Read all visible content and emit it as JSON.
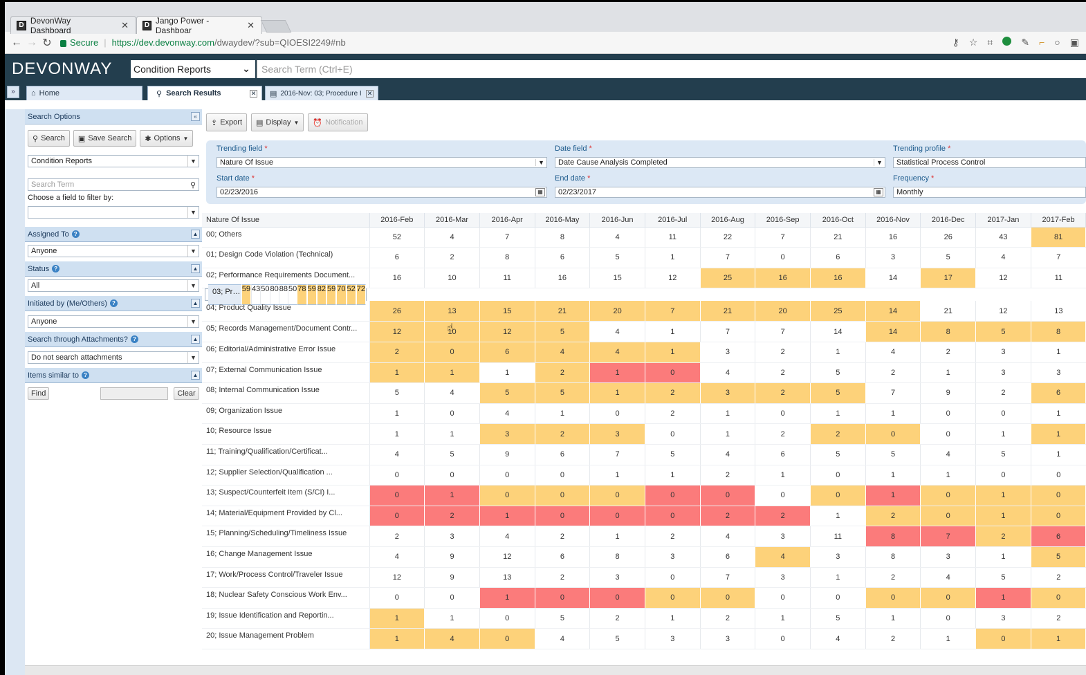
{
  "browser": {
    "tabs": [
      {
        "label": "DevonWay Dashboard",
        "active": false
      },
      {
        "label": "Jango Power - Dashboar",
        "active": true
      }
    ],
    "secure_label": "Secure",
    "url_scheme_host": "https://dev.devonway.com",
    "url_rest": "/dwaydev/?sub=QIOESI2249#nb"
  },
  "app": {
    "logo": "DEVONWAY",
    "module": "Condition Reports",
    "search_placeholder": "Search Term (Ctrl+E)",
    "tabs": [
      {
        "label": "Home"
      },
      {
        "label": "Search Results"
      },
      {
        "label": "2016-Nov: 03; Procedure I"
      }
    ]
  },
  "left": {
    "header": "Search Options",
    "buttons": [
      "Search",
      "Save Search",
      "Options"
    ],
    "module_select": "Condition Reports",
    "search_placeholder": "Search Term",
    "filter_label": "Choose a field to filter by:",
    "filter_value": "",
    "filters": [
      {
        "label": "Assigned To",
        "value": "Anyone"
      },
      {
        "label": "Status",
        "value": "All"
      },
      {
        "label": "Initiated by (Me/Others)",
        "value": "Anyone"
      },
      {
        "label": "Search through Attachments?",
        "value": "Do not search attachments"
      }
    ],
    "similar_label": "Items similar to",
    "find_label": "Find",
    "clear_label": "Clear"
  },
  "toolbar": {
    "export": "Export",
    "display": "Display",
    "notification": "Notification"
  },
  "criteria": {
    "trending_field_label": "Trending field",
    "trending_field": "Nature Of Issue",
    "date_field_label": "Date field",
    "date_field": "Date Cause Analysis Completed",
    "trending_profile_label": "Trending profile",
    "trending_profile": "Statistical Process Control",
    "start_date_label": "Start date",
    "start_date": "02/23/2016",
    "end_date_label": "End date",
    "end_date": "02/23/2017",
    "frequency_label": "Frequency",
    "frequency": "Monthly"
  },
  "grid": {
    "first_header": "Nature Of Issue",
    "months": [
      "2016-Feb",
      "2016-Mar",
      "2016-Apr",
      "2016-May",
      "2016-Jun",
      "2016-Jul",
      "2016-Aug",
      "2016-Sep",
      "2016-Oct",
      "2016-Nov",
      "2016-Dec",
      "2017-Jan",
      "2017-Feb"
    ],
    "colors": {
      "y": "#fdd27a",
      "r": "#fb7b7b",
      "w": "#ffffff"
    },
    "rows": [
      {
        "label": "00; Others",
        "values": [
          52,
          4,
          7,
          8,
          4,
          11,
          22,
          7,
          21,
          16,
          26,
          43,
          81
        ],
        "c": "wwwwwwwwwwwwy"
      },
      {
        "label": "01; Design Code Violation (Technical)",
        "values": [
          6,
          2,
          8,
          6,
          5,
          1,
          7,
          0,
          6,
          3,
          5,
          4,
          7
        ],
        "c": "wwwwwwwwwwwww"
      },
      {
        "label": "02; Performance Requirements Document...",
        "values": [
          16,
          10,
          11,
          16,
          15,
          12,
          25,
          16,
          16,
          14,
          17,
          12,
          11
        ],
        "c": "wwwwwwyyywyww"
      },
      {
        "label": "03; Procedure Implementation Issue",
        "values": [
          59,
          43,
          50,
          80,
          88,
          50,
          78,
          59,
          82,
          59,
          70,
          52,
          72
        ],
        "c": "ywwwwwyyyyyyy",
        "selected": true
      },
      {
        "label": "04; Product Quality Issue",
        "values": [
          26,
          13,
          15,
          21,
          20,
          7,
          21,
          20,
          25,
          14,
          21,
          12,
          13
        ],
        "c": "yyyyyyyyyywww"
      },
      {
        "label": "05; Records Management/Document Contr...",
        "values": [
          12,
          10,
          12,
          5,
          4,
          1,
          7,
          7,
          14,
          14,
          8,
          5,
          8
        ],
        "c": "yyyywwwwwyyyy"
      },
      {
        "label": "06; Editorial/Administrative Error Issue",
        "values": [
          2,
          0,
          6,
          4,
          4,
          1,
          3,
          2,
          1,
          4,
          2,
          3,
          1
        ],
        "c": "yyyyyywwwwwww"
      },
      {
        "label": "07; External Communication Issue",
        "values": [
          1,
          1,
          1,
          2,
          1,
          0,
          4,
          2,
          5,
          2,
          1,
          3,
          3
        ],
        "c": "yywyrrwwwwwww"
      },
      {
        "label": "08; Internal Communication Issue",
        "values": [
          5,
          4,
          5,
          5,
          1,
          2,
          3,
          2,
          5,
          7,
          9,
          2,
          6
        ],
        "c": "wwyyyyyyywwwy"
      },
      {
        "label": "09; Organization Issue",
        "values": [
          1,
          0,
          4,
          1,
          0,
          2,
          1,
          0,
          1,
          1,
          0,
          0,
          1
        ],
        "c": "wwwwwwwwwwwww"
      },
      {
        "label": "10; Resource Issue",
        "values": [
          1,
          1,
          3,
          2,
          3,
          0,
          1,
          2,
          2,
          0,
          0,
          1,
          1
        ],
        "c": "wwyyywwwyywwy"
      },
      {
        "label": "11; Training/Qualification/Certificat...",
        "values": [
          4,
          5,
          9,
          6,
          7,
          5,
          4,
          6,
          5,
          5,
          4,
          5,
          1
        ],
        "c": "wwwwwwwwwwwww"
      },
      {
        "label": "12; Supplier Selection/Qualification ...",
        "values": [
          0,
          0,
          0,
          0,
          1,
          1,
          2,
          1,
          0,
          1,
          1,
          0,
          0
        ],
        "c": "wwwwwwwwwwwww"
      },
      {
        "label": "13; Suspect/Counterfeit Item (S/CI) I...",
        "values": [
          0,
          1,
          0,
          0,
          0,
          0,
          0,
          0,
          0,
          1,
          0,
          1,
          0
        ],
        "c": "rryyyrrwyryyy"
      },
      {
        "label": "14; Material/Equipment Provided by Cl...",
        "values": [
          0,
          2,
          1,
          0,
          0,
          0,
          2,
          2,
          1,
          2,
          0,
          1,
          0
        ],
        "c": "rrrrrrrrwyyyy"
      },
      {
        "label": "15; Planning/Scheduling/Timeliness Issue",
        "values": [
          2,
          3,
          4,
          2,
          1,
          2,
          4,
          3,
          11,
          8,
          7,
          2,
          6
        ],
        "c": "wwwwwwwwwrryr"
      },
      {
        "label": "16; Change Management Issue",
        "values": [
          4,
          9,
          12,
          6,
          8,
          3,
          6,
          4,
          3,
          8,
          3,
          1,
          5
        ],
        "c": "wwwwwwwywwwwy"
      },
      {
        "label": "17; Work/Process Control/Traveler Issue",
        "values": [
          12,
          9,
          13,
          2,
          3,
          0,
          7,
          3,
          1,
          2,
          4,
          5,
          2
        ],
        "c": "wwwwwwwwwwwww"
      },
      {
        "label": "18; Nuclear Safety Conscious Work Env...",
        "values": [
          0,
          0,
          1,
          0,
          0,
          0,
          0,
          0,
          0,
          0,
          0,
          1,
          0
        ],
        "c": "wwrrryywwyyry"
      },
      {
        "label": "19; Issue Identification and Reportin...",
        "values": [
          1,
          1,
          0,
          5,
          2,
          1,
          2,
          1,
          5,
          1,
          0,
          3,
          2
        ],
        "c": "ywwwwwwwwwwww"
      },
      {
        "label": "20; Issue Management Problem",
        "values": [
          1,
          4,
          0,
          4,
          5,
          3,
          3,
          0,
          4,
          2,
          1,
          0,
          1
        ],
        "c": "yyywwwwwwwwyy"
      }
    ]
  }
}
